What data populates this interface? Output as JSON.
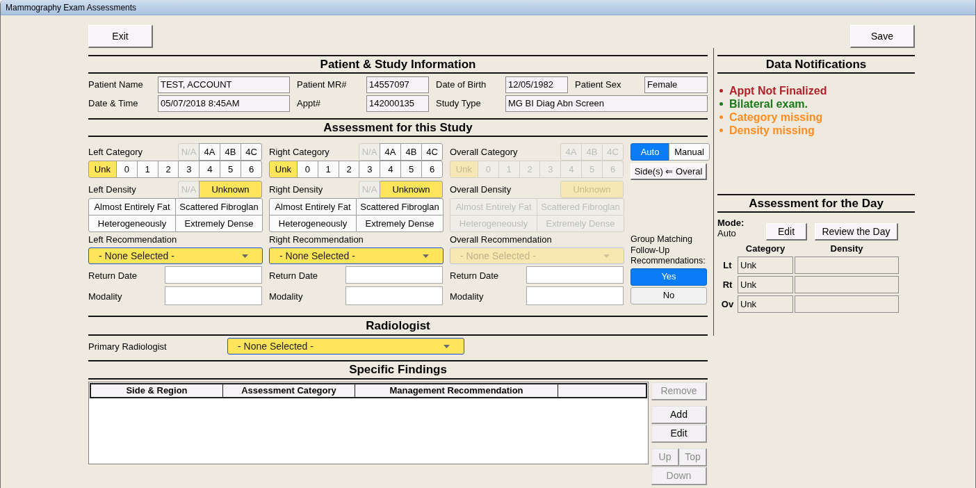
{
  "window": {
    "title": "Mammography Exam Assessments"
  },
  "top_buttons": {
    "exit": "Exit",
    "save": "Save"
  },
  "patient_info": {
    "title": "Patient & Study Information",
    "rows": [
      [
        {
          "label": "Patient Name",
          "value": "TEST, ACCOUNT"
        },
        {
          "label": "Patient MR#",
          "value": "14557097"
        },
        {
          "label": "Date of Birth",
          "value": "12/05/1982"
        },
        {
          "label": "Patient Sex",
          "value": "Female"
        }
      ],
      [
        {
          "label": "Date & Time",
          "value": "05/07/2018 8:45AM"
        },
        {
          "label": "Appt#",
          "value": "142000135"
        },
        {
          "label": "Study Type",
          "value": "MG BI Diag Abn Screen"
        }
      ]
    ]
  },
  "assessment": {
    "title": "Assessment for this Study",
    "sides": [
      {
        "category_label": "Left Category",
        "category_top": [
          {
            "label": "N/A",
            "selected": false,
            "disabled": true
          },
          {
            "label": "4A",
            "selected": false,
            "disabled": false
          },
          {
            "label": "4B",
            "selected": false,
            "disabled": false
          },
          {
            "label": "4C",
            "selected": false,
            "disabled": false
          }
        ],
        "category_bottom": [
          {
            "label": "Unk",
            "selected": true,
            "disabled": false
          },
          {
            "label": "0",
            "selected": false,
            "disabled": false
          },
          {
            "label": "1",
            "selected": false,
            "disabled": false
          },
          {
            "label": "2",
            "selected": false,
            "disabled": false
          },
          {
            "label": "3",
            "selected": false,
            "disabled": false
          },
          {
            "label": "4",
            "selected": false,
            "disabled": false
          },
          {
            "label": "5",
            "selected": false,
            "disabled": false
          },
          {
            "label": "6",
            "selected": false,
            "disabled": false
          }
        ],
        "density_label": "Left Density",
        "density_top": [
          {
            "label": "N/A",
            "selected": false,
            "disabled": true
          },
          {
            "label": "Unknown",
            "selected": true,
            "disabled": false
          }
        ],
        "density_options": [
          {
            "label": "Almost Entirely Fat",
            "selected": false,
            "disabled": false
          },
          {
            "label": "Scattered Fibroglan",
            "selected": false,
            "disabled": false
          },
          {
            "label": "Heterogeneously",
            "selected": false,
            "disabled": false
          },
          {
            "label": "Extremely Dense",
            "selected": false,
            "disabled": false
          }
        ],
        "recommendation_label": "Left Recommendation",
        "recommendation": {
          "value": "- None Selected -",
          "disabled": false
        },
        "return_date_label": "Return Date",
        "modality_label": "Modality"
      },
      {
        "category_label": "Right Category",
        "category_top": [
          {
            "label": "N/A",
            "selected": false,
            "disabled": true
          },
          {
            "label": "4A",
            "selected": false,
            "disabled": false
          },
          {
            "label": "4B",
            "selected": false,
            "disabled": false
          },
          {
            "label": "4C",
            "selected": false,
            "disabled": false
          }
        ],
        "category_bottom": [
          {
            "label": "Unk",
            "selected": true,
            "disabled": false
          },
          {
            "label": "0",
            "selected": false,
            "disabled": false
          },
          {
            "label": "1",
            "selected": false,
            "disabled": false
          },
          {
            "label": "2",
            "selected": false,
            "disabled": false
          },
          {
            "label": "3",
            "selected": false,
            "disabled": false
          },
          {
            "label": "4",
            "selected": false,
            "disabled": false
          },
          {
            "label": "5",
            "selected": false,
            "disabled": false
          },
          {
            "label": "6",
            "selected": false,
            "disabled": false
          }
        ],
        "density_label": "Right Density",
        "density_top": [
          {
            "label": "N/A",
            "selected": false,
            "disabled": true
          },
          {
            "label": "Unknown",
            "selected": true,
            "disabled": false
          }
        ],
        "density_options": [
          {
            "label": "Almost Entirely Fat",
            "selected": false,
            "disabled": false
          },
          {
            "label": "Scattered Fibroglan",
            "selected": false,
            "disabled": false
          },
          {
            "label": "Heterogeneously",
            "selected": false,
            "disabled": false
          },
          {
            "label": "Extremely Dense",
            "selected": false,
            "disabled": false
          }
        ],
        "recommendation_label": "Right Recommendation",
        "recommendation": {
          "value": "- None Selected -",
          "disabled": false
        },
        "return_date_label": "Return Date",
        "modality_label": "Modality"
      },
      {
        "category_label": "Overall Category",
        "category_top": [
          {
            "label": "4A",
            "selected": false,
            "disabled": true
          },
          {
            "label": "4B",
            "selected": false,
            "disabled": true
          },
          {
            "label": "4C",
            "selected": false,
            "disabled": true
          }
        ],
        "category_bottom": [
          {
            "label": "Unk",
            "selected": true,
            "disabled": true
          },
          {
            "label": "0",
            "selected": false,
            "disabled": true
          },
          {
            "label": "1",
            "selected": false,
            "disabled": true
          },
          {
            "label": "2",
            "selected": false,
            "disabled": true
          },
          {
            "label": "3",
            "selected": false,
            "disabled": true
          },
          {
            "label": "4",
            "selected": false,
            "disabled": true
          },
          {
            "label": "5",
            "selected": false,
            "disabled": true
          },
          {
            "label": "6",
            "selected": false,
            "disabled": true
          }
        ],
        "density_label": "Overall Density",
        "density_top": [
          {
            "label": "Unknown",
            "selected": true,
            "disabled": true
          }
        ],
        "density_options": [
          {
            "label": "Almost Entirely Fat",
            "selected": false,
            "disabled": true
          },
          {
            "label": "Scattered Fibroglan",
            "selected": false,
            "disabled": true
          },
          {
            "label": "Heterogeneously",
            "selected": false,
            "disabled": true
          },
          {
            "label": "Extremely Dense",
            "selected": false,
            "disabled": true
          }
        ],
        "recommendation_label": "Overall Recommendation",
        "recommendation": {
          "value": "- None Selected -",
          "disabled": true
        },
        "return_date_label": "Return Date",
        "modality_label": "Modality"
      }
    ],
    "mode_toggle": [
      {
        "label": "Auto",
        "selected": true
      },
      {
        "label": "Manual",
        "selected": false
      }
    ],
    "copy_button": "Side(s) ⇐ Overal",
    "group_matching": {
      "label": "Group Matching Follow-Up Recommendations:",
      "options": [
        {
          "label": "Yes",
          "selected": true
        },
        {
          "label": "No",
          "selected": false
        }
      ]
    }
  },
  "radiologist": {
    "title": "Radiologist",
    "label": "Primary Radiologist",
    "dropdown": {
      "value": "- None Selected -"
    }
  },
  "findings": {
    "title": "Specific Findings",
    "columns": [
      "Side & Region",
      "Assessment Category",
      "Management Recommendation"
    ],
    "buttons": {
      "remove": {
        "label": "Remove",
        "disabled": true
      },
      "add": {
        "label": "Add",
        "disabled": false
      },
      "edit": {
        "label": "Edit",
        "disabled": false
      },
      "up": {
        "label": "Up",
        "disabled": true
      },
      "top": {
        "label": "Top",
        "disabled": true
      },
      "down": {
        "label": "Down",
        "disabled": true
      }
    }
  },
  "notifications": {
    "title": "Data Notifications",
    "items": [
      {
        "text": "Appt Not Finalized",
        "color": "#b3202a"
      },
      {
        "text": "Bilateral exam.",
        "color": "#1a7a1a"
      },
      {
        "text": "Category missing",
        "color": "#ff8c1e"
      },
      {
        "text": "Density missing",
        "color": "#ff8c1e"
      }
    ]
  },
  "day_assessment": {
    "title": "Assessment for the Day",
    "mode_label": "Mode:",
    "mode_value": "Auto",
    "edit_button": "Edit",
    "review_button": "Review the Day",
    "columns": [
      "Category",
      "Density"
    ],
    "rows": [
      {
        "label": "Lt",
        "category": "Unk"
      },
      {
        "label": "Rt",
        "category": "Unk"
      },
      {
        "label": "Ov",
        "category": "Unk"
      }
    ]
  }
}
